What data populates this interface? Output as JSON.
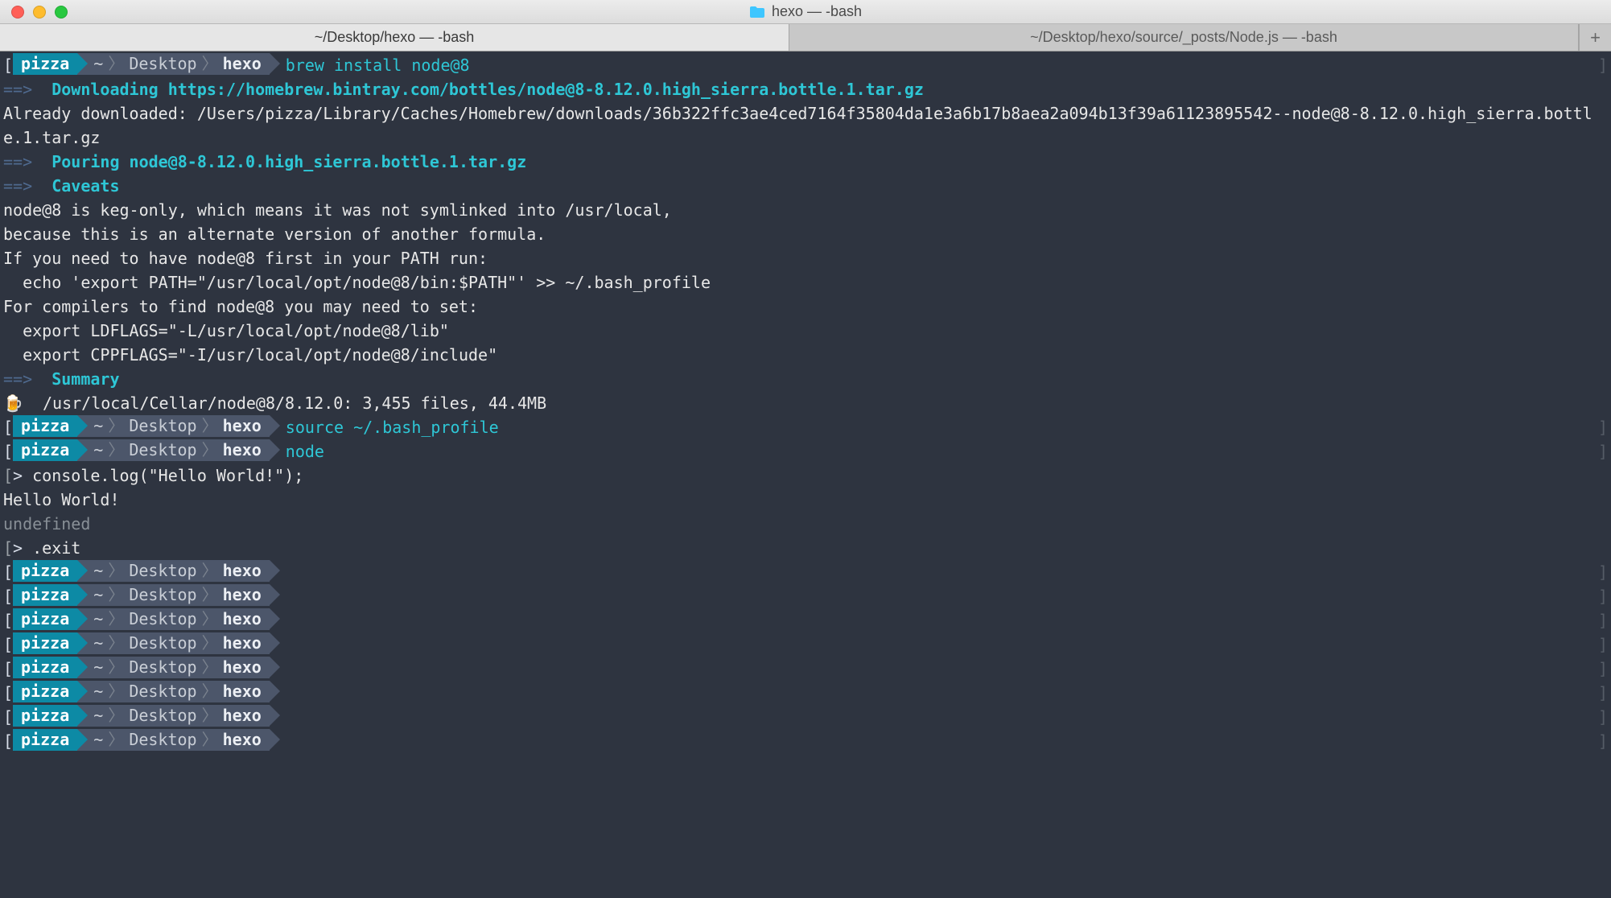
{
  "window": {
    "title": "hexo — -bash",
    "folder_icon_color": "#3ec6ff"
  },
  "tabs": {
    "active": "~/Desktop/hexo — -bash",
    "inactive": "~/Desktop/hexo/source/_posts/Node.js — -bash",
    "newtab_glyph": "+"
  },
  "prompt": {
    "user": "pizza",
    "home": "~",
    "desktop": "Desktop",
    "dir": "hexo"
  },
  "commands": {
    "c1": "brew install node@8",
    "c2": "source ~/.bash_profile",
    "c3": "node"
  },
  "brew": {
    "arrow": "==>",
    "downloading_label": "Downloading",
    "downloading_url": "https://homebrew.bintray.com/bottles/node@8-8.12.0.high_sierra.bottle.1.tar.gz",
    "already_downloaded": "Already downloaded: /Users/pizza/Library/Caches/Homebrew/downloads/36b322ffc3ae4ced7164f35804da1e3a6b17b8aea2a094b13f39a61123895542--node@8-8.12.0.high_sierra.bottle.1.tar.gz",
    "pouring_label": "Pouring",
    "pouring_file": "node@8-8.12.0.high_sierra.bottle.1.tar.gz",
    "caveats_label": "Caveats",
    "caveats_body": "node@8 is keg-only, which means it was not symlinked into /usr/local,\nbecause this is an alternate version of another formula.\n\nIf you need to have node@8 first in your PATH run:\n  echo 'export PATH=\"/usr/local/opt/node@8/bin:$PATH\"' >> ~/.bash_profile\n\nFor compilers to find node@8 you may need to set:\n  export LDFLAGS=\"-L/usr/local/opt/node@8/lib\"\n  export CPPFLAGS=\"-I/usr/local/opt/node@8/include\"\n",
    "summary_label": "Summary",
    "summary_emoji": "🍺",
    "summary_text": "/usr/local/Cellar/node@8/8.12.0: 3,455 files, 44.4MB"
  },
  "repl": {
    "prompt": ">",
    "line1": "console.log(\"Hello World!\");",
    "out1": "Hello World!",
    "out2": "undefined",
    "exit": ".exit"
  },
  "empty_prompt_count": 8
}
